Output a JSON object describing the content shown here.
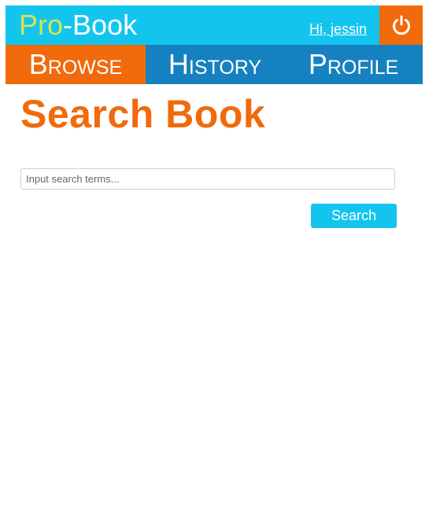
{
  "header": {
    "logo_pro": "Pro",
    "logo_rest": "-Book",
    "greeting": "Hi, jessin",
    "logout_icon": "power-icon"
  },
  "nav": {
    "tabs": [
      {
        "label": "Browse",
        "active": true
      },
      {
        "label": "History",
        "active": false
      },
      {
        "label": "Profile",
        "active": false
      }
    ]
  },
  "main": {
    "title": "Search Book",
    "search_placeholder": "Input search terms...",
    "search_value": "",
    "search_button": "Search"
  },
  "colors": {
    "header_bg": "#13c5ee",
    "accent_orange": "#f16a0b",
    "nav_blue": "#1681c0",
    "logo_pro": "#d8e34a"
  }
}
